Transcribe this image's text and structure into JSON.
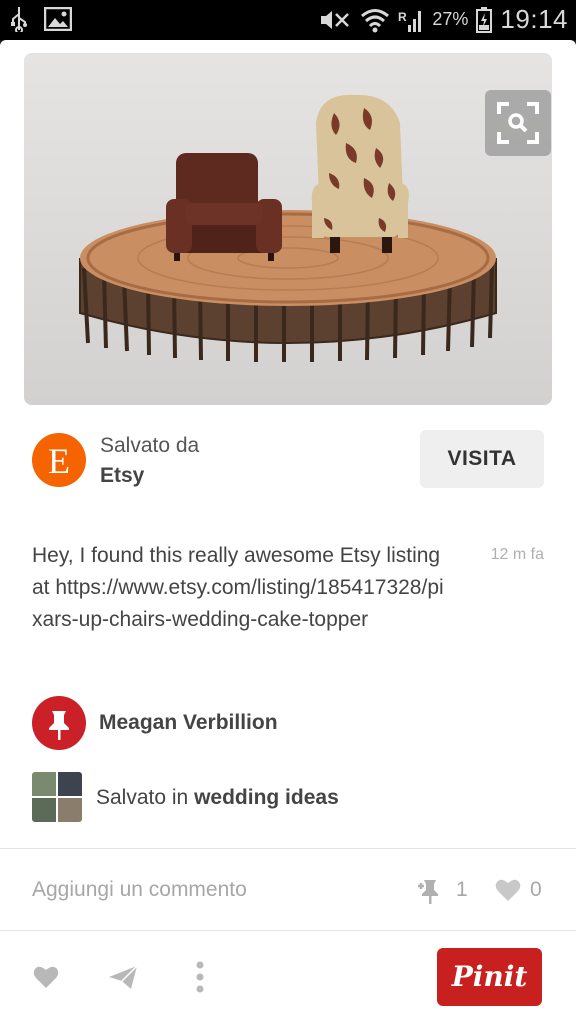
{
  "status_bar": {
    "battery_percent": "27%",
    "time": "19:14",
    "icons": [
      "usb-icon",
      "image-icon",
      "mute-icon",
      "wifi-icon",
      "signal-icon",
      "battery-icon"
    ]
  },
  "pin": {
    "image_alt": "Two miniature armchairs on a wooden log slice",
    "source": {
      "saved_from_label": "Salvato da",
      "name": "Etsy",
      "logo_letter": "E",
      "logo_color": "#f56400"
    },
    "visit_button": "VISITA",
    "description": "Hey, I found this really awesome Etsy listing at https://www.etsy.com/listing/185417328/pixars-up-chairs-wedding-cake-topper",
    "timestamp": "12 m fa",
    "pinner": {
      "name": "Meagan Verbillion"
    },
    "board": {
      "prefix": "Salvato in ",
      "name": "wedding ideas"
    },
    "comment_placeholder": "Aggiungi un commento",
    "repin_count": "1",
    "like_count": "0",
    "pinit_label": "Pinit"
  },
  "colors": {
    "pinterest_red": "#cb2027",
    "etsy_orange": "#f56400",
    "muted_gray": "#a7a7a7"
  }
}
